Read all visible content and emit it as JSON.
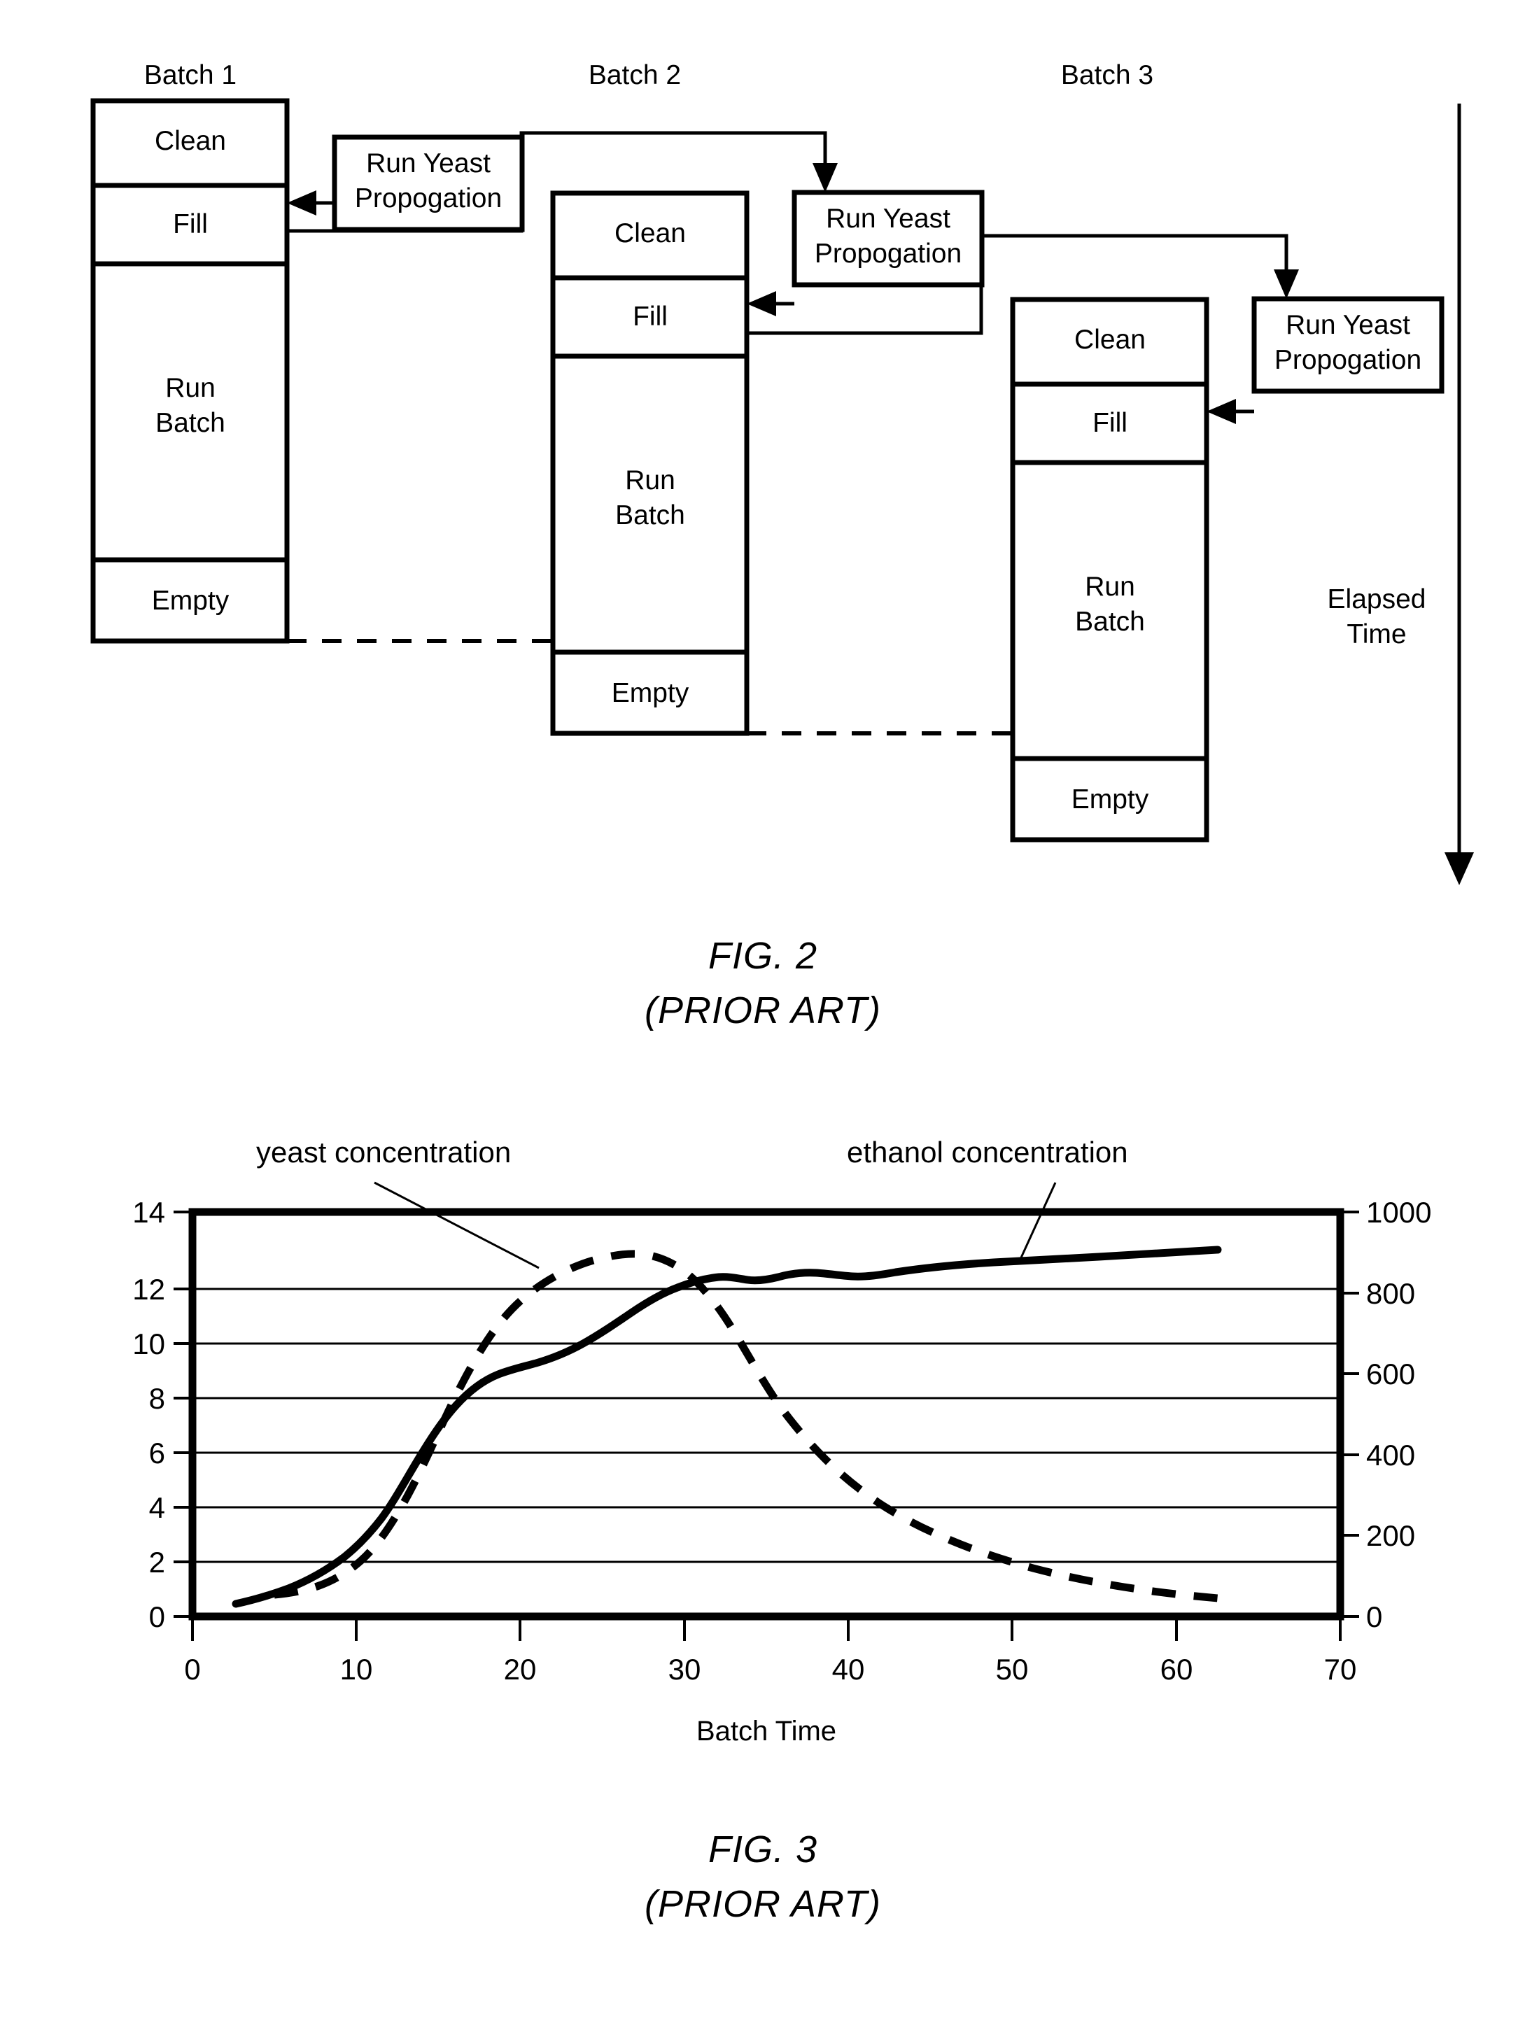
{
  "figure2": {
    "caption_title": "FIG. 2",
    "caption_sub": "(PRIOR ART)",
    "time_axis_label_line1": "Elapsed",
    "time_axis_label_line2": "Time",
    "yeast_box_line1": "Run Yeast",
    "yeast_box_line2": "Propogation",
    "batches": [
      {
        "header": "Batch 1",
        "stages": [
          {
            "label": "Clean"
          },
          {
            "label": "Fill"
          },
          {
            "label": "Run",
            "label2": "Batch"
          },
          {
            "label": "Empty"
          }
        ]
      },
      {
        "header": "Batch 2",
        "stages": [
          {
            "label": "Clean"
          },
          {
            "label": "Fill"
          },
          {
            "label": "Run",
            "label2": "Batch"
          },
          {
            "label": "Empty"
          }
        ]
      },
      {
        "header": "Batch 3",
        "stages": [
          {
            "label": "Clean"
          },
          {
            "label": "Fill"
          },
          {
            "label": "Run",
            "label2": "Batch"
          },
          {
            "label": "Empty"
          }
        ]
      }
    ]
  },
  "figure3": {
    "caption_title": "FIG. 3",
    "caption_sub": "(PRIOR ART)"
  },
  "chart_data": {
    "type": "line",
    "title": "",
    "xlabel": "Batch Time",
    "ylabel": "",
    "ylabel_right": "",
    "xlim": [
      0,
      70
    ],
    "ylim": [
      0,
      14
    ],
    "ylim_right": [
      0,
      1000
    ],
    "xticks": [
      0,
      10,
      20,
      30,
      40,
      50,
      60,
      70
    ],
    "yticks": [
      0,
      2,
      4,
      6,
      8,
      10,
      12,
      14
    ],
    "yticks_right": [
      0,
      200,
      400,
      600,
      800,
      1000
    ],
    "grid": "horizontal",
    "legend": "annotations",
    "annotations": [
      {
        "text": "yeast concentration",
        "points_to_series": "yeast concentration"
      },
      {
        "text": "ethanol concentration",
        "points_to_series": "ethanol concentration"
      }
    ],
    "series": [
      {
        "name": "ethanol concentration",
        "axis": "left",
        "style": "solid",
        "x": [
          3.5,
          5,
          7,
          9,
          11,
          12.5,
          14,
          15.5,
          17,
          18.5,
          20,
          21.5,
          23,
          25,
          27,
          29,
          31,
          33,
          34.5,
          36,
          37.5,
          39,
          41,
          43,
          45,
          48,
          51,
          54,
          57,
          60.5
        ],
        "y": [
          0.75,
          0.95,
          1.25,
          1.65,
          2.3,
          3.0,
          3.9,
          4.9,
          6.0,
          7.1,
          7.9,
          8.3,
          8.8,
          9.5,
          10.2,
          10.8,
          11.4,
          11.9,
          12.2,
          12.15,
          12.25,
          12.35,
          12.4,
          12.35,
          12.45,
          12.6,
          12.7,
          12.8,
          12.9,
          13.05
        ]
      },
      {
        "name": "yeast concentration",
        "axis": "right",
        "style": "dashed",
        "x": [
          5,
          7,
          9,
          11,
          12.5,
          14,
          15.5,
          17,
          18.5,
          20,
          21.5,
          23,
          24.5,
          26,
          27.5,
          29,
          31,
          33,
          35,
          37,
          39,
          41,
          43,
          45,
          47,
          49,
          51,
          53,
          55,
          57,
          59,
          60.5
        ],
        "y": [
          0,
          25,
          65,
          140,
          230,
          350,
          480,
          610,
          730,
          830,
          900,
          930,
          935,
          910,
          860,
          790,
          700,
          620,
          540,
          470,
          400,
          340,
          290,
          245,
          210,
          180,
          155,
          135,
          120,
          105,
          95,
          88
        ]
      }
    ]
  }
}
